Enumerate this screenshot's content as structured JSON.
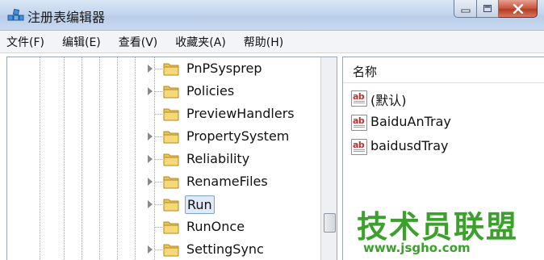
{
  "window": {
    "title": "注册表编辑器"
  },
  "menu": [
    "文件(F)",
    "编辑(E)",
    "查看(V)",
    "收藏夹(A)",
    "帮助(H)"
  ],
  "tree": {
    "nodes": [
      {
        "label": "PnPSysprep",
        "expandable": true
      },
      {
        "label": "Policies",
        "expandable": true
      },
      {
        "label": "PreviewHandlers",
        "expandable": false
      },
      {
        "label": "PropertySystem",
        "expandable": true
      },
      {
        "label": "Reliability",
        "expandable": true
      },
      {
        "label": "RenameFiles",
        "expandable": true
      },
      {
        "label": "Run",
        "expandable": true,
        "selected": true
      },
      {
        "label": "RunOnce",
        "expandable": false
      },
      {
        "label": "SettingSync",
        "expandable": true
      }
    ]
  },
  "values": {
    "column_name": "名称",
    "items": [
      {
        "name": "(默认)",
        "icon": "ab-string-icon"
      },
      {
        "name": "BaiduAnTray",
        "icon": "ab-string-icon"
      },
      {
        "name": "baidusdTray",
        "icon": "ab-string-icon"
      }
    ]
  },
  "watermark": {
    "title": "技术员联盟",
    "url": "www.jsgho.com"
  },
  "colors": {
    "watermark_green": "#3aa12b",
    "selection_bg": "#dfeaf8",
    "close_button": "#c8543c"
  }
}
